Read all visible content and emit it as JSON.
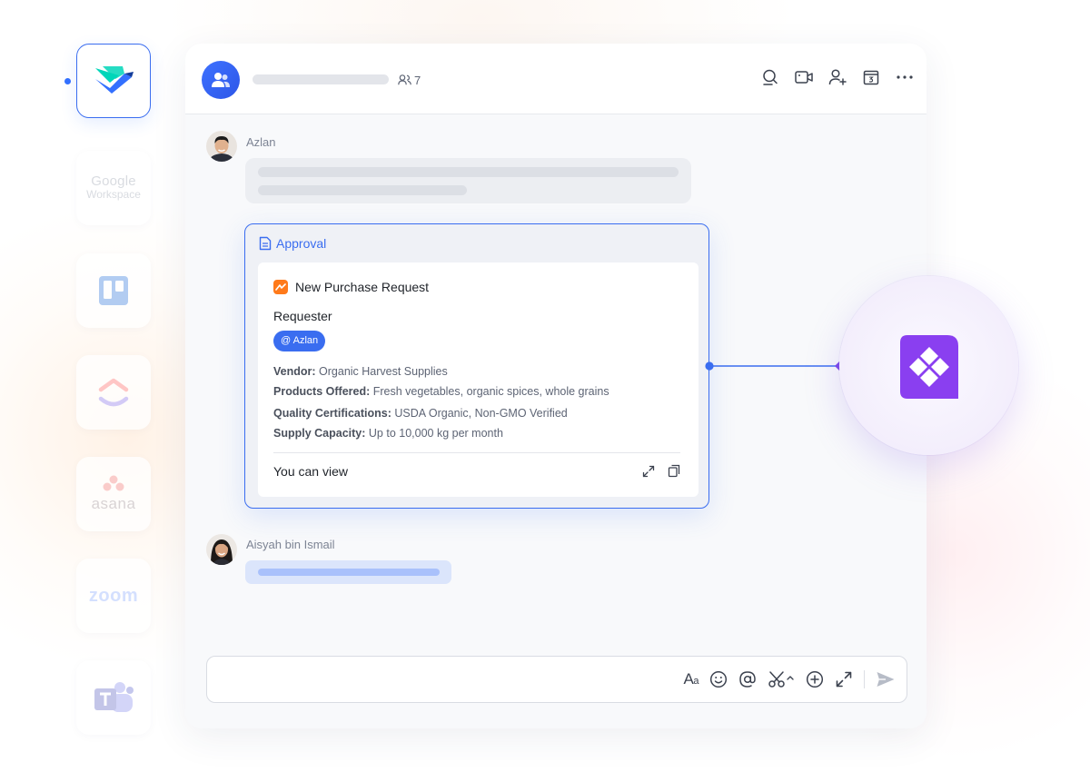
{
  "member_count": "7",
  "messages": [
    {
      "sender": "Azlan"
    },
    {
      "sender": "Aisyah bin Ismail"
    }
  ],
  "approval": {
    "header": "Approval",
    "title": "New Purchase Request",
    "requester_label": "Requester",
    "requester_mention": "@ Azlan",
    "fields": [
      {
        "key": "Vendor:",
        "value": "Organic Harvest Supplies"
      },
      {
        "key": "Products Offered:",
        "value": "Fresh vegetables, organic spices, whole grains"
      },
      {
        "key": "Quality Certifications:",
        "value": "USDA Organic, Non-GMO Verified"
      },
      {
        "key": "Supply Capacity:",
        "value": "Up to 10,000 kg per month"
      }
    ],
    "permission_label": "You can view"
  },
  "apps": [
    {
      "name": "lark-icon",
      "active": true
    },
    {
      "name": "google-workspace-icon",
      "text_line1": "Google",
      "text_line2": "Workspace"
    },
    {
      "name": "trello-icon"
    },
    {
      "name": "clickup-icon"
    },
    {
      "name": "asana-icon",
      "text": "asana"
    },
    {
      "name": "zoom-icon",
      "text": "zoom"
    },
    {
      "name": "teams-icon"
    }
  ],
  "header_icons": [
    "search-icon",
    "video-icon",
    "add-member-icon",
    "calendar-icon",
    "more-icon"
  ],
  "composer_tools": [
    "text-format-icon",
    "emoji-icon",
    "mention-icon",
    "screenshot-icon",
    "add-icon",
    "expand-icon",
    "send-icon"
  ],
  "colors": {
    "accent": "#3a6df0",
    "integration": "#8a3ff0",
    "orange": "#ff7a1a"
  }
}
